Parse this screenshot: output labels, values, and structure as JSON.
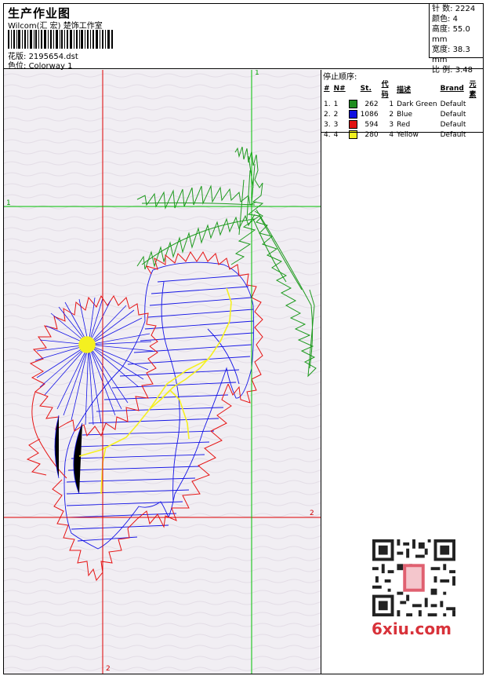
{
  "header": {
    "title": "生产作业图",
    "studio": "Wilcom(汇 宏) 楚饰工作室",
    "design_label": "花版:",
    "design_value": "2195654.dst",
    "colorway_label": "色位:",
    "colorway_value": "Colorway 1"
  },
  "specs": {
    "stitches_label": "针 数:",
    "stitches_value": "2224",
    "colors_label": "颜色:",
    "colors_value": "4",
    "height_label": "高度:",
    "height_value": "55.0 mm",
    "width_label": "宽度:",
    "width_value": "38.3 mm",
    "scale_label": "比 例:",
    "scale_value": "3.48"
  },
  "stop_sequence": {
    "title": "停止顺序:",
    "columns": [
      "#",
      "N#",
      "St.",
      "代码",
      "描述",
      "Brand",
      "元素"
    ],
    "rows": [
      {
        "num": "1.",
        "n": "1",
        "color": "#1e8c1e",
        "st": "262",
        "code": "1",
        "desc": "Dark Green",
        "brand": "Default"
      },
      {
        "num": "2.",
        "n": "2",
        "color": "#1010e0",
        "st": "1086",
        "code": "2",
        "desc": "Blue",
        "brand": "Default"
      },
      {
        "num": "3.",
        "n": "3",
        "color": "#e01010",
        "st": "594",
        "code": "3",
        "desc": "Red",
        "brand": "Default"
      },
      {
        "num": "4.",
        "n": "4",
        "color": "#f0f020",
        "st": "280",
        "code": "4",
        "desc": "Yellow",
        "brand": "Default"
      }
    ]
  },
  "guides": {
    "label_top_1": "1",
    "label_left_1": "1",
    "label_right_2": "2",
    "label_bottom_2": "2"
  },
  "watermark": {
    "text": "6xiu.com"
  },
  "colors": {
    "green": "#1e9a1e",
    "blue": "#1414e6",
    "red": "#e61414",
    "yellow": "#f4f020",
    "guide_red": "#e00000",
    "guide_green": "#00c000",
    "canvas_bg": "#f1eef3"
  }
}
